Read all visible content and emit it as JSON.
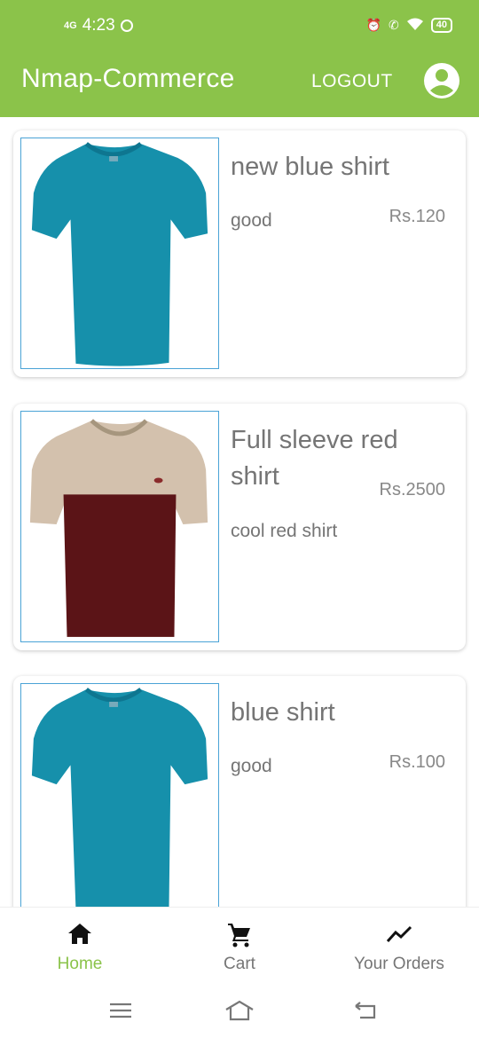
{
  "status_bar": {
    "network": "4G",
    "time": "4:23",
    "battery": "40"
  },
  "app_bar": {
    "title": "Nmap-Commerce",
    "logout_label": "LOGOUT",
    "profile_icon": "account-circle-icon"
  },
  "products": [
    {
      "name": "new blue shirt",
      "description": "good",
      "price": "Rs.120",
      "image": "blue-tshirt"
    },
    {
      "name": "Full sleeve red shirt",
      "description": "cool red shirt",
      "price": "Rs.2500",
      "image": "red-beige-tshirt"
    },
    {
      "name": "blue shirt",
      "description": "good",
      "price": "Rs.100",
      "image": "blue-tshirt"
    }
  ],
  "bottom_nav": {
    "home": {
      "label": "Home",
      "icon": "home-icon",
      "active": true
    },
    "cart": {
      "label": "Cart",
      "icon": "cart-icon",
      "active": false
    },
    "orders": {
      "label": "Your Orders",
      "icon": "trending-icon",
      "active": false
    }
  },
  "colors": {
    "primary": "#8bc34a",
    "text": "#757575",
    "thumb_border": "#4aa3d6"
  }
}
